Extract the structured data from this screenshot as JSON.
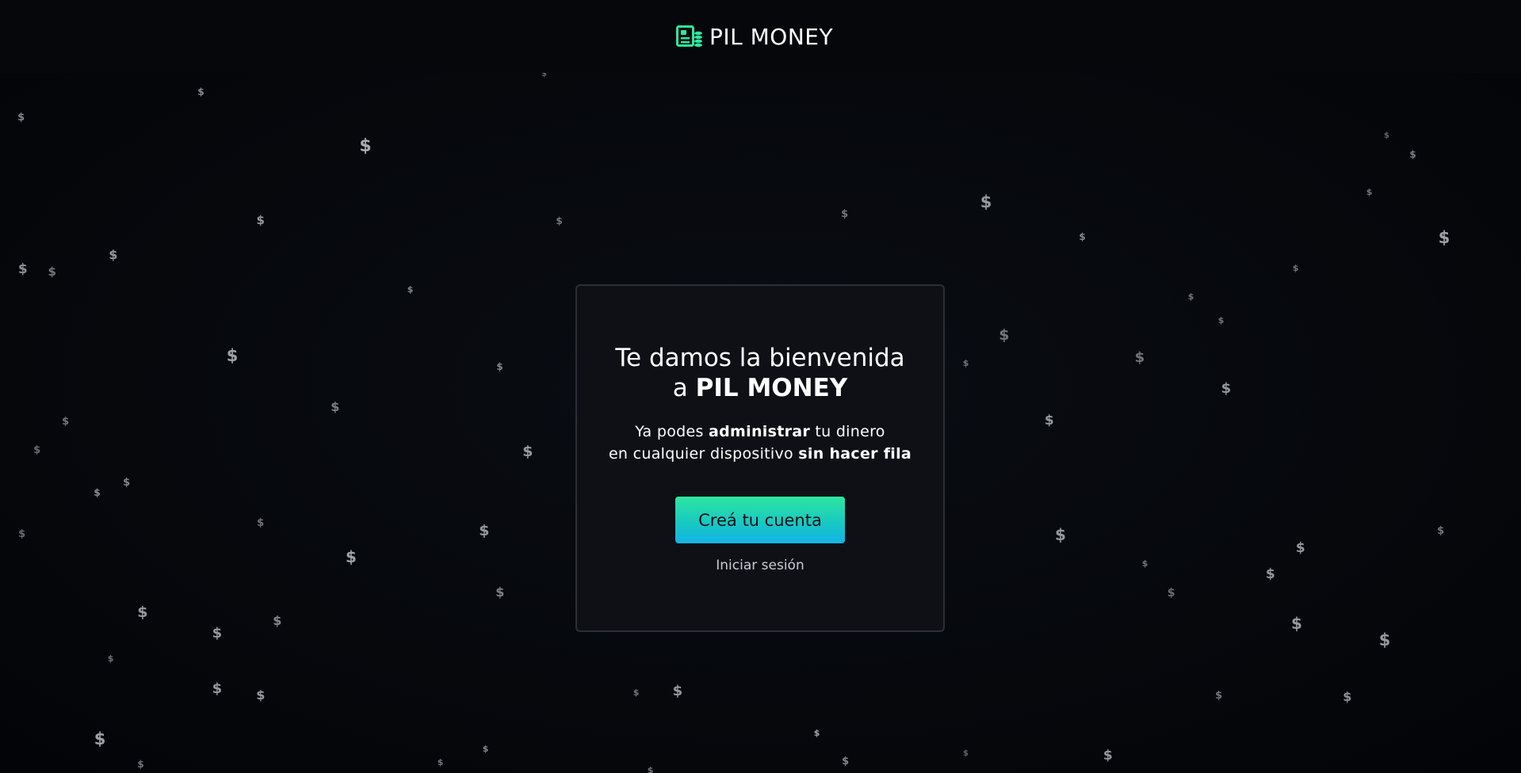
{
  "header": {
    "brand_name": "PIL MONEY",
    "brand_icon": "money-stack-icon",
    "brand_color": "#2ee6a0"
  },
  "card": {
    "title_line1": "Te damos la bienvenida",
    "title_line2_prefix": "a ",
    "title_line2_strong": "PIL MONEY",
    "subtitle_line1_a": "Ya podes ",
    "subtitle_line1_b": "administrar",
    "subtitle_line1_c": " tu dinero",
    "subtitle_line2_a": "en cualquier dispositivo ",
    "subtitle_line2_b": "sin hacer fila",
    "cta_label": "Creá tu cuenta",
    "login_label": "Iniciar sesión"
  },
  "background": {
    "symbol": "$",
    "symbol_color": "#b9bdc4",
    "accent_gradient": [
      "#2ee6a0",
      "#12b4e6"
    ]
  }
}
